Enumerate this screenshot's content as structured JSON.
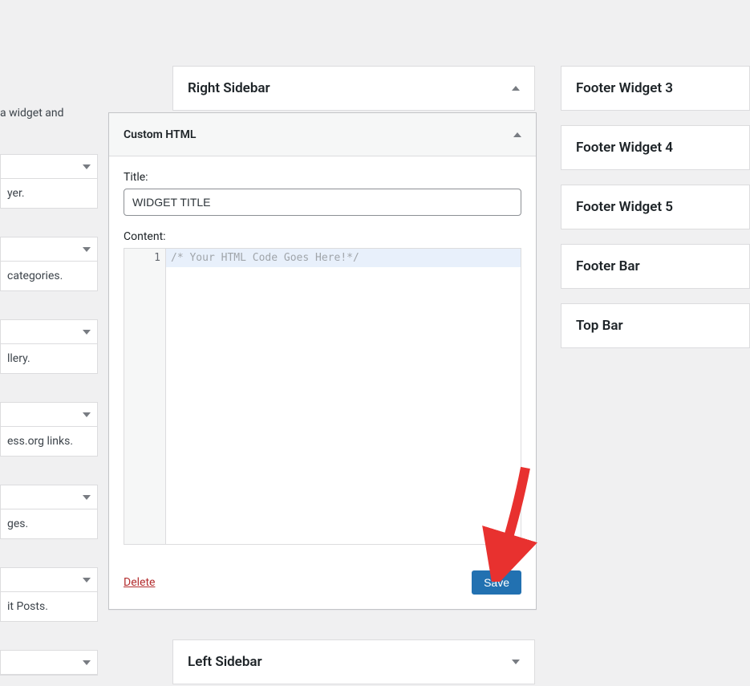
{
  "left": {
    "desc_fragment": "a widget and",
    "widgets": [
      {
        "desc": "yer."
      },
      {
        "desc": "categories."
      },
      {
        "desc": "llery."
      },
      {
        "desc": "ess.org links."
      },
      {
        "desc": "ges."
      },
      {
        "desc": "it Posts."
      }
    ]
  },
  "center": {
    "right_sidebar_title": "Right Sidebar",
    "left_sidebar_title": "Left Sidebar"
  },
  "widget": {
    "name": "Custom HTML",
    "title_label": "Title:",
    "title_value": "WIDGET TITLE",
    "content_label": "Content:",
    "line_number": "1",
    "code_placeholder": "/* Your HTML Code Goes Here!*/",
    "delete_label": "Delete",
    "save_label": "Save"
  },
  "right_areas": [
    "Footer Widget 3",
    "Footer Widget 4",
    "Footer Widget 5",
    "Footer Bar",
    "Top Bar"
  ]
}
